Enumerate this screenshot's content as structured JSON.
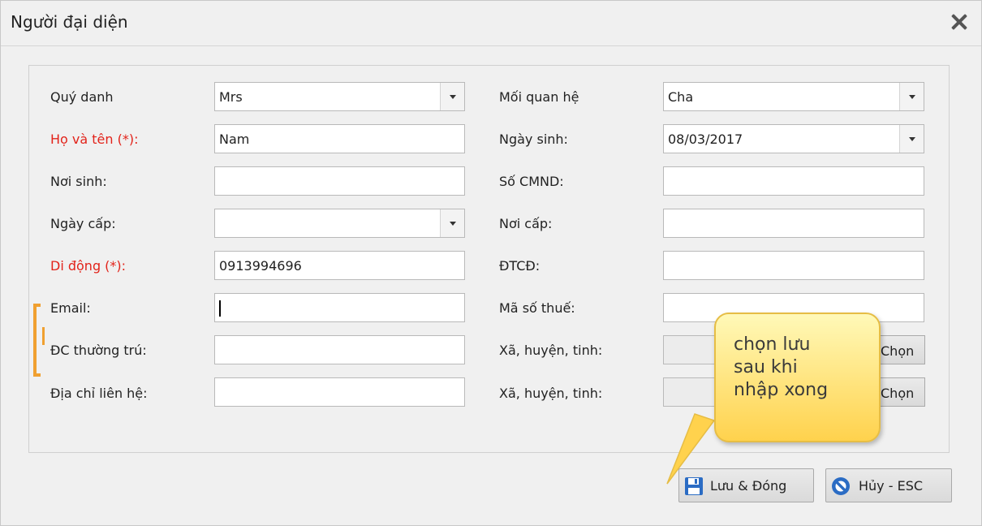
{
  "dialog": {
    "title": "Người đại diện"
  },
  "form": {
    "left": [
      {
        "label": "Quý danh",
        "value": "Mrs",
        "type": "dropdown"
      },
      {
        "label": "Họ và tên (*):",
        "value": "Nam",
        "type": "text",
        "required": true
      },
      {
        "label": "Nơi sinh:",
        "value": "",
        "type": "text"
      },
      {
        "label": "Ngày cấp:",
        "value": "",
        "type": "dropdown"
      },
      {
        "label": "Di động (*):",
        "value": "0913994696",
        "type": "text",
        "required": true
      },
      {
        "label": "Email:",
        "value": "",
        "type": "text",
        "focused": true
      },
      {
        "label": "ĐC thường trú:",
        "value": "",
        "type": "text"
      },
      {
        "label": "Địa chỉ liên hệ:",
        "value": "",
        "type": "text"
      }
    ],
    "right": [
      {
        "label": "Mối quan hệ",
        "value": "Cha",
        "type": "dropdown"
      },
      {
        "label": "Ngày sinh:",
        "value": "08/03/2017",
        "type": "dropdown"
      },
      {
        "label": "Số CMND:",
        "value": "",
        "type": "text"
      },
      {
        "label": "Nơi cấp:",
        "value": "",
        "type": "text"
      },
      {
        "label": "ĐTCĐ:",
        "value": "",
        "type": "text"
      },
      {
        "label": "Mã số thuế:",
        "value": "",
        "type": "text"
      },
      {
        "label": "Xã, huyện, tinh:",
        "value": "",
        "type": "chooser",
        "button": "Chọn"
      },
      {
        "label": "Xã, huyện, tinh:",
        "value": "",
        "type": "chooser",
        "button": "Chọn"
      }
    ]
  },
  "buttons": {
    "save": "Lưu & Đóng",
    "cancel": "Hủy - ESC"
  },
  "icons": {
    "close": "close-icon",
    "save": "floppy-disk-icon",
    "cancel": "no-entry-icon"
  },
  "callout": {
    "lines": [
      "chọn lưu",
      "sau khi",
      "nhập xong"
    ]
  },
  "colors": {
    "required_label": "#e2231a",
    "callout_fill": "#ffd24d",
    "bracket": "#f0a030",
    "save_icon": "#2b6cc4"
  }
}
